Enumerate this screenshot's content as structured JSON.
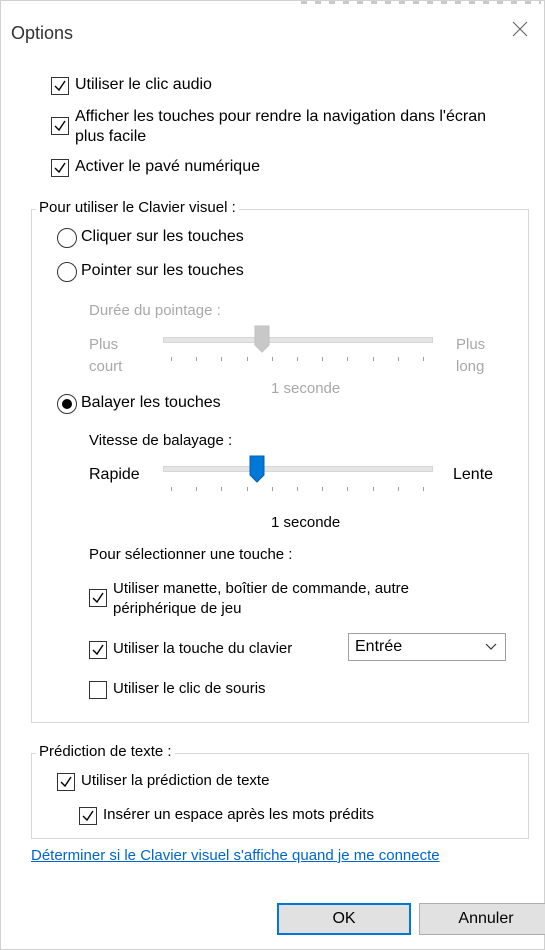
{
  "window": {
    "title": "Options"
  },
  "options": {
    "audio_click": {
      "label": "Utiliser le clic audio",
      "checked": true
    },
    "show_keys": {
      "label_line1": "Afficher les touches pour rendre la navigation dans l'écran",
      "label_line2": "plus facile",
      "checked": true
    },
    "numpad": {
      "label": "Activer le pavé numérique",
      "checked": true
    }
  },
  "visual_keyboard": {
    "group_label": "Pour utiliser le Clavier visuel :",
    "click_keys": {
      "label": "Cliquer sur les touches",
      "selected": false
    },
    "hover_keys": {
      "label": "Pointer sur les touches",
      "selected": false
    },
    "hover_duration": {
      "label": "Durée du pointage :",
      "left_line1": "Plus",
      "left_line2": "court",
      "right_line1": "Plus",
      "right_line2": "long",
      "value_text": "1 seconde",
      "level": 0.36
    },
    "scan_keys": {
      "label": "Balayer les touches",
      "selected": true
    },
    "scan_speed": {
      "label": "Vitesse de balayage :",
      "left": "Rapide",
      "right": "Lente",
      "value_text": "1 seconde",
      "level": 0.34
    },
    "select_key_label": "Pour sélectionner une touche :",
    "use_gamepad": {
      "label_line1": "Utiliser manette, boîtier de commande, autre",
      "label_line2": "périphérique de jeu",
      "checked": true
    },
    "use_keyboard_key": {
      "label": "Utiliser la touche du clavier",
      "checked": true,
      "selected_key": "Entrée"
    },
    "use_mouse_click": {
      "label": "Utiliser le clic de souris",
      "checked": false
    }
  },
  "text_prediction": {
    "group_label": "Prédiction de texte :",
    "use_prediction": {
      "label": "Utiliser la prédiction de texte",
      "checked": true
    },
    "insert_space": {
      "label": "Insérer un espace après les mots prédits",
      "checked": true
    }
  },
  "link": "Déterminer si le Clavier visuel s'affiche quand je me connecte",
  "buttons": {
    "ok": "OK",
    "cancel": "Annuler"
  },
  "colors": {
    "accent": "#0078d7",
    "link": "#0066cc",
    "disabled": "#a8a8a8"
  },
  "icons": {
    "close": "close-icon",
    "check": "check-icon",
    "chevron": "chevron-down-icon"
  }
}
